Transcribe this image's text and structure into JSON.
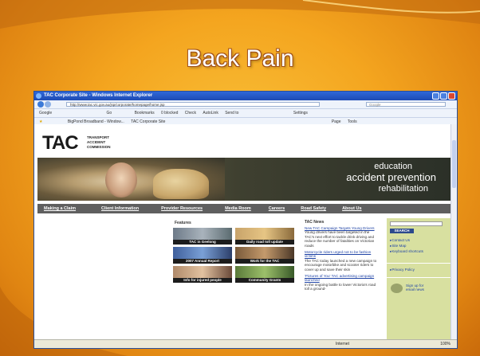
{
  "slide": {
    "title": "Back Pain"
  },
  "browser": {
    "window_title": "TAC Corporate Site - Windows Internet Explorer",
    "address": "http://www.tac.vic.gov.au/jsp/corporate/homepage/home.jsp",
    "search_placeholder": "Google",
    "toolbar_items": [
      "Google",
      "Go",
      "Bookmarks",
      "0 blocked",
      "Check",
      "AutoLink",
      "Send to",
      "Settings"
    ],
    "tabs": [
      "BigPond Broadband - Window...",
      "TAC Corporate Site"
    ],
    "command_items": [
      "Page",
      "Tools"
    ],
    "status_zone": "Internet",
    "status_zoom": "100%"
  },
  "site": {
    "logo": "TAC",
    "logo_subtitle": [
      "TRANSPORT",
      "ACCIDENT",
      "COMMISSION"
    ],
    "hero_lines": [
      "education",
      "accident prevention",
      "rehabilitation"
    ],
    "menu": [
      "Making a Claim",
      "Client Information",
      "Provider Resources",
      "Media Room",
      "Careers",
      "Road Safety",
      "About Us"
    ],
    "features_label": "Features",
    "features": [
      {
        "caption": "TAC in Geelong"
      },
      {
        "caption": "Daily road toll update"
      },
      {
        "caption": "2007 Annual Report"
      },
      {
        "caption": "Work for the TAC"
      },
      {
        "caption": "Info for injured people"
      },
      {
        "caption": "Community Grants"
      }
    ],
    "news_label": "TAC News",
    "news": [
      {
        "link": "New TAC Campaign Targets Young Drivers",
        "text": "Young drivers have been targeted in the TAC's next effort to tackle drink driving and reduce the number of fatalities on Victorian roads"
      },
      {
        "link": "Motorcycle riders urged not to be fashion victims",
        "text": "The TAC today launched a new campaign to encourage motorbike and scooter riders to cover up and save their skin"
      },
      {
        "link": "'Pictures of You' TAC advertising campaign launched",
        "text": "In the ongoing battle to lower Victoria's road toll a ground-"
      }
    ],
    "sidebar": {
      "search_button": "SEARCH",
      "links": [
        "Contact Us",
        "Site Map",
        "Keyboard shortcuts"
      ],
      "privacy": "Privacy Policy",
      "signup": [
        "Sign up for",
        "email news"
      ]
    }
  }
}
